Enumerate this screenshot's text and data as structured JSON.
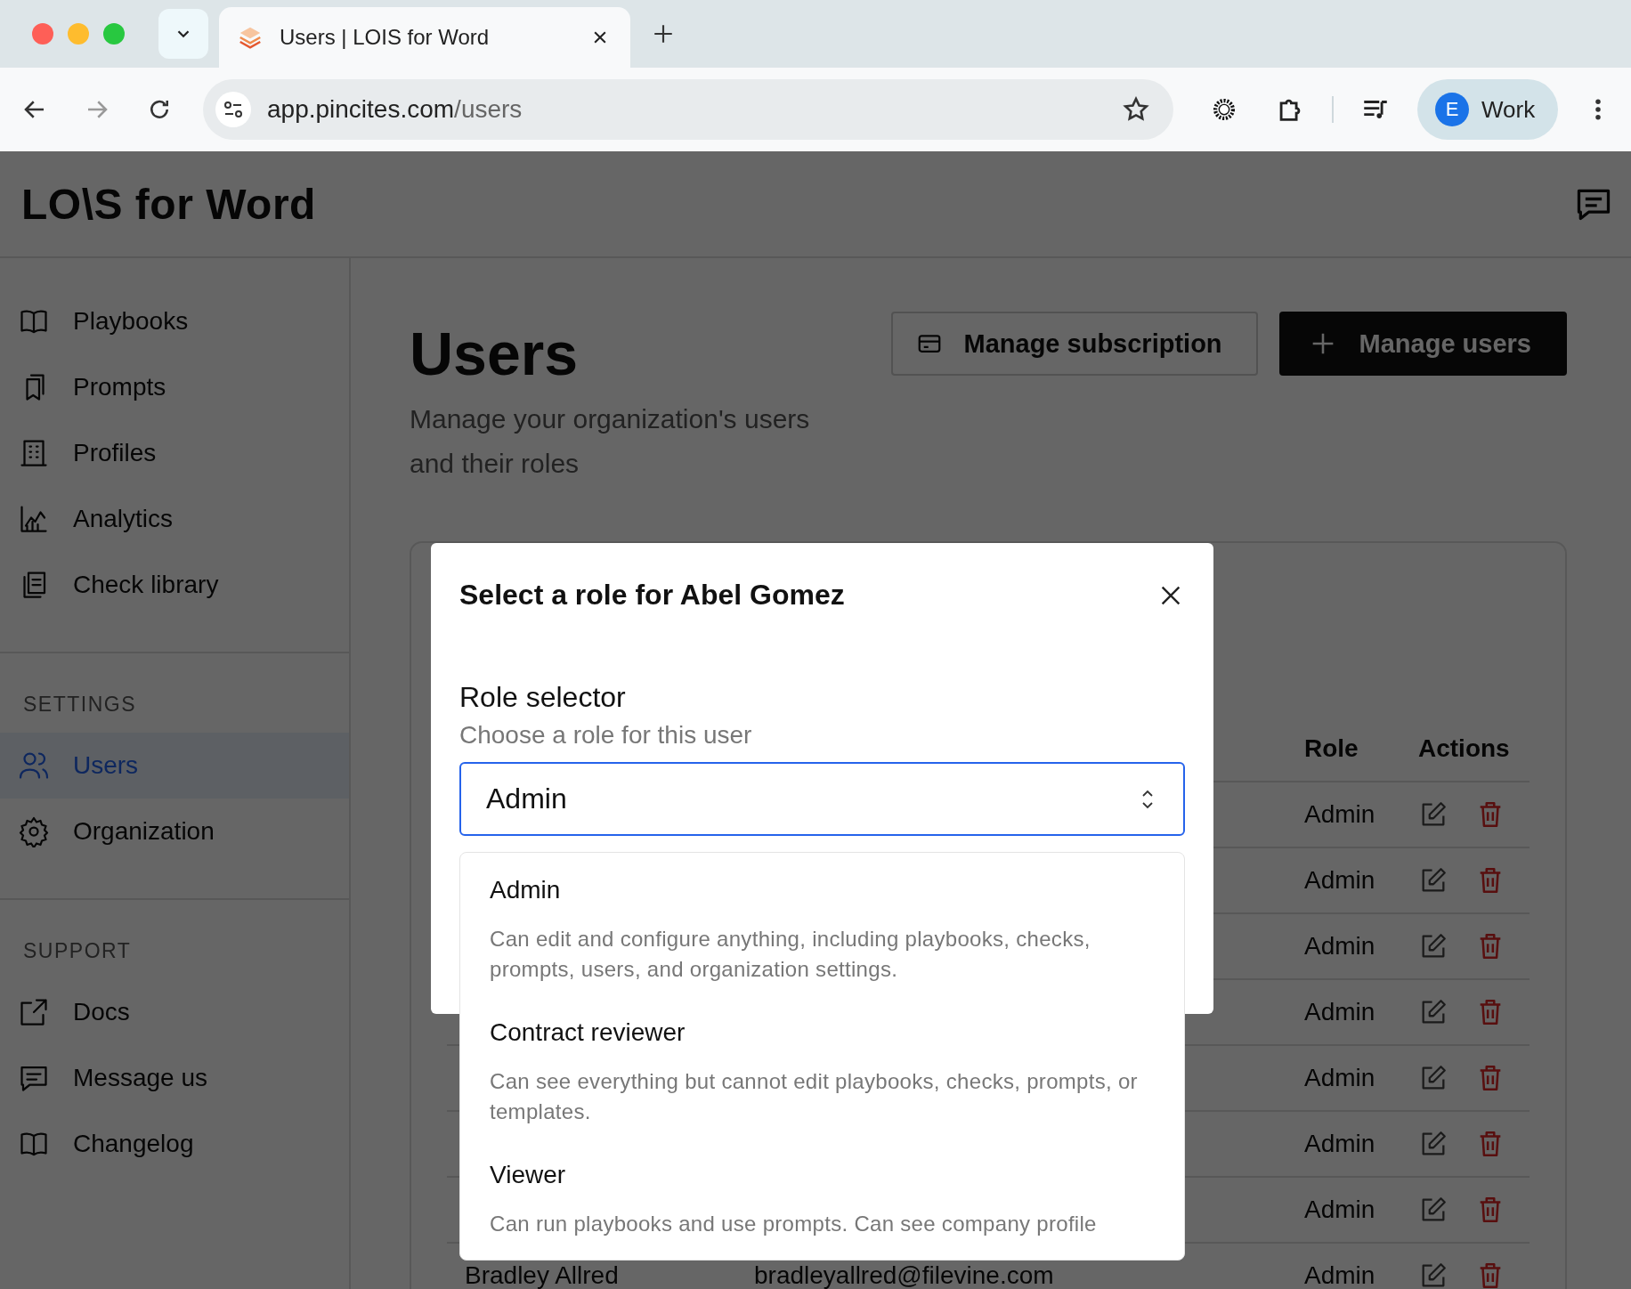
{
  "browser": {
    "tab_title": "Users | LOIS for Word",
    "url_host": "app.pincites.com",
    "url_path": "/users",
    "profile_initial": "E",
    "profile_name": "Work"
  },
  "app": {
    "logo": "LO\\S for Word"
  },
  "sidebar": {
    "sections": [
      {
        "items": [
          {
            "label": "Playbooks",
            "selected": false
          },
          {
            "label": "Prompts",
            "selected": false
          },
          {
            "label": "Profiles",
            "selected": false
          },
          {
            "label": "Analytics",
            "selected": false
          },
          {
            "label": "Check library",
            "selected": false
          }
        ]
      },
      {
        "heading": "SETTINGS",
        "items": [
          {
            "label": "Users",
            "selected": true
          },
          {
            "label": "Organization",
            "selected": false
          }
        ]
      },
      {
        "heading": "SUPPORT",
        "items": [
          {
            "label": "Docs",
            "selected": false
          },
          {
            "label": "Message us",
            "selected": false
          },
          {
            "label": "Changelog",
            "selected": false
          }
        ]
      }
    ]
  },
  "page": {
    "title": "Users",
    "subtitle": "Manage your organization's users and their roles",
    "buttons": [
      {
        "label": "Manage subscription",
        "kind": "secondary"
      },
      {
        "label": "Manage users",
        "kind": "primary"
      }
    ]
  },
  "table": {
    "columns": [
      "Role",
      "Actions"
    ],
    "rows": [
      {
        "role": "Admin"
      },
      {
        "role": "Admin"
      },
      {
        "role": "Admin"
      },
      {
        "role": "Admin"
      },
      {
        "role": "Admin"
      },
      {
        "role": "Admin"
      },
      {
        "role": "Admin"
      },
      {
        "name": "Bradley Allred",
        "email": "bradleyallred@filevine.com",
        "role": "Admin"
      }
    ]
  },
  "modal": {
    "title": "Select a role for Abel Gomez",
    "field_label": "Role selector",
    "field_hint": "Choose a role for this user",
    "value": "Admin",
    "options": [
      {
        "title": "Admin",
        "description": "Can edit and configure anything, including playbooks, checks, prompts, users, and organization settings."
      },
      {
        "title": "Contract reviewer",
        "description": "Can see everything but cannot edit playbooks, checks, prompts, or templates."
      },
      {
        "title": "Viewer",
        "description": "Can run playbooks and use prompts. Can see company profile"
      }
    ]
  }
}
